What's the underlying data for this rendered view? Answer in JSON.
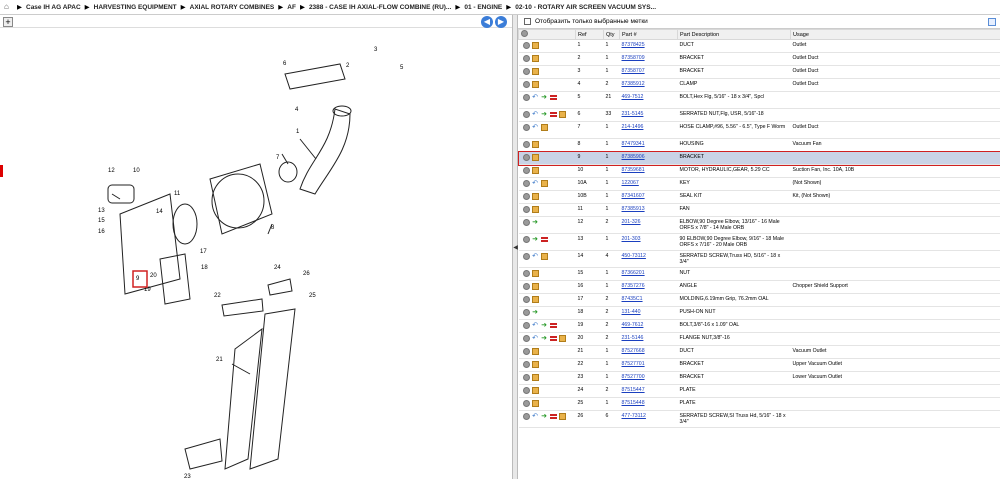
{
  "breadcrumb": {
    "items": [
      "Case IH AG APAC",
      "HARVESTING EQUIPMENT",
      "AXIAL ROTARY COMBINES",
      "AF",
      "2388 - CASE IH AXIAL-FLOW COMBINE (RU)...",
      "01 - ENGINE",
      "02-10 - ROTARY AIR SCREEN VACUUM SYS..."
    ]
  },
  "toolbar": {
    "zoom_label": "+",
    "back_label": "◀",
    "forward_label": "▶"
  },
  "filter": {
    "label": "Отобразить только выбранные метки"
  },
  "table": {
    "headers": [
      "",
      "Ref",
      "Qty",
      "Part #",
      "Part Description",
      "Usage"
    ],
    "rows": [
      {
        "icons": [
          "search",
          "box"
        ],
        "ref": "1",
        "qty": "1",
        "part": "87378425",
        "desc": "DUCT",
        "usage": "Outlet"
      },
      {
        "icons": [
          "search",
          "box"
        ],
        "ref": "2",
        "qty": "1",
        "part": "87358709",
        "desc": "BRACKET",
        "usage": "Outlet Duct"
      },
      {
        "icons": [
          "search",
          "box"
        ],
        "ref": "3",
        "qty": "1",
        "part": "87358707",
        "desc": "BRACKET",
        "usage": "Outlet Duct"
      },
      {
        "icons": [
          "search",
          "box"
        ],
        "ref": "4",
        "qty": "2",
        "part": "87385912",
        "desc": "CLAMP",
        "usage": "Outlet Duct"
      },
      {
        "icons": [
          "search",
          "back",
          "go",
          "flag"
        ],
        "ref": "5",
        "qty": "21",
        "part": "469-7512",
        "desc": "BOLT,Hex Flg, 5/16\" - 18 x 3/4\", Spcl",
        "usage": ""
      },
      {
        "icons": [
          "search",
          "back",
          "go",
          "flag",
          "box"
        ],
        "ref": "6",
        "qty": "33",
        "part": "231-5145",
        "desc": "SERRATED NUT,Flg, USR, 5/16\"-18",
        "usage": ""
      },
      {
        "icons": [
          "search",
          "back",
          "box"
        ],
        "ref": "7",
        "qty": "1",
        "part": "214-1496",
        "desc": "HOSE CLAMP,#96, 5.56\" - 6.5\", Type F Worm",
        "usage": "Outlet Duct"
      },
      {
        "icons": [
          "search",
          "box"
        ],
        "ref": "8",
        "qty": "1",
        "part": "87479341",
        "desc": "HOUSING",
        "usage": "Vacuum Fan"
      },
      {
        "icons": [
          "search",
          "box"
        ],
        "ref": "9",
        "qty": "1",
        "part": "87385906",
        "desc": "BRACKET",
        "usage": "",
        "selected": true
      },
      {
        "icons": [
          "search",
          "box"
        ],
        "ref": "10",
        "qty": "1",
        "part": "87359681",
        "desc": "MOTOR, HYDRAULIC,GEAR, 5.29 CC",
        "usage": "Suction Fan, Inc. 10A, 10B"
      },
      {
        "icons": [
          "search",
          "back",
          "box"
        ],
        "ref": "10A",
        "qty": "1",
        "part": "122067",
        "desc": "KEY",
        "usage": "(Not Shown)"
      },
      {
        "icons": [
          "search",
          "box"
        ],
        "ref": "10B",
        "qty": "1",
        "part": "87341607",
        "desc": "SEAL KIT",
        "usage": "Kit, (Not Shown)"
      },
      {
        "icons": [
          "search",
          "box"
        ],
        "ref": "11",
        "qty": "1",
        "part": "87385913",
        "desc": "FAN",
        "usage": ""
      },
      {
        "icons": [
          "search",
          "go"
        ],
        "ref": "12",
        "qty": "2",
        "part": "201-326",
        "desc": "ELBOW,90 Degree Elbow, 13/16\" - 16 Male ORFS x 7/8\" - 14 Male ORB",
        "usage": ""
      },
      {
        "icons": [
          "search",
          "go",
          "flag"
        ],
        "ref": "13",
        "qty": "1",
        "part": "201-303",
        "desc": "90 ELBOW,90 Degree Elbow, 9/16\" - 18 Male ORFS x 7/16\" - 20 Male ORB",
        "usage": ""
      },
      {
        "icons": [
          "search",
          "back",
          "box"
        ],
        "ref": "14",
        "qty": "4",
        "part": "450-73112",
        "desc": "SERRATED SCREW,Truss HD, 5/16\" - 18 x 3/4\"",
        "usage": ""
      },
      {
        "icons": [
          "search",
          "box"
        ],
        "ref": "15",
        "qty": "1",
        "part": "87366201",
        "desc": "NUT",
        "usage": ""
      },
      {
        "icons": [
          "search",
          "box"
        ],
        "ref": "16",
        "qty": "1",
        "part": "87357276",
        "desc": "ANGLE",
        "usage": "Chopper Shield Support"
      },
      {
        "icons": [
          "search",
          "box"
        ],
        "ref": "17",
        "qty": "2",
        "part": "87435C1",
        "desc": "MOLDING,6.19mm Grip, 76.2mm OAL",
        "usage": ""
      },
      {
        "icons": [
          "search",
          "go"
        ],
        "ref": "18",
        "qty": "2",
        "part": "131-440",
        "desc": "PUSH-ON NUT",
        "usage": ""
      },
      {
        "icons": [
          "search",
          "back",
          "go",
          "flag"
        ],
        "ref": "19",
        "qty": "2",
        "part": "469-7612",
        "desc": "BOLT,3/8\"-16 x 1.09\" OAL",
        "usage": ""
      },
      {
        "icons": [
          "search",
          "back",
          "go",
          "flag",
          "box"
        ],
        "ref": "20",
        "qty": "2",
        "part": "231-5146",
        "desc": "FLANGE NUT,3/8\"-16",
        "usage": ""
      },
      {
        "icons": [
          "search",
          "box"
        ],
        "ref": "21",
        "qty": "1",
        "part": "87527668",
        "desc": "DUCT",
        "usage": "Vacuum Outlet"
      },
      {
        "icons": [
          "search",
          "box"
        ],
        "ref": "22",
        "qty": "1",
        "part": "87527701",
        "desc": "BRACKET",
        "usage": "Upper Vacuum Outlet"
      },
      {
        "icons": [
          "search",
          "box"
        ],
        "ref": "23",
        "qty": "1",
        "part": "87527700",
        "desc": "BRACKET",
        "usage": "Lower Vacuum Outlet"
      },
      {
        "icons": [
          "search",
          "box"
        ],
        "ref": "24",
        "qty": "2",
        "part": "87515447",
        "desc": "PLATE",
        "usage": ""
      },
      {
        "icons": [
          "search",
          "box"
        ],
        "ref": "25",
        "qty": "1",
        "part": "87515448",
        "desc": "PLATE",
        "usage": ""
      },
      {
        "icons": [
          "search",
          "back",
          "go",
          "flag",
          "box"
        ],
        "ref": "26",
        "qty": "6",
        "part": "477-73112",
        "desc": "SERRATED SCREW,SI Truss Hd, 5/16\" - 18 x 3/4\"",
        "usage": ""
      }
    ]
  },
  "diagram": {
    "labels": [
      "1",
      "2",
      "3",
      "4",
      "5",
      "6",
      "7",
      "8",
      "9",
      "10",
      "11",
      "12",
      "13",
      "14",
      "15",
      "16",
      "17",
      "18",
      "19",
      "20",
      "21",
      "22",
      "23",
      "24",
      "25",
      "26"
    ]
  },
  "colors": {
    "link": "#1a3fbf",
    "selected_row": "#c9d3e6",
    "highlight": "#d02020",
    "nav": "#3b7dd8"
  }
}
